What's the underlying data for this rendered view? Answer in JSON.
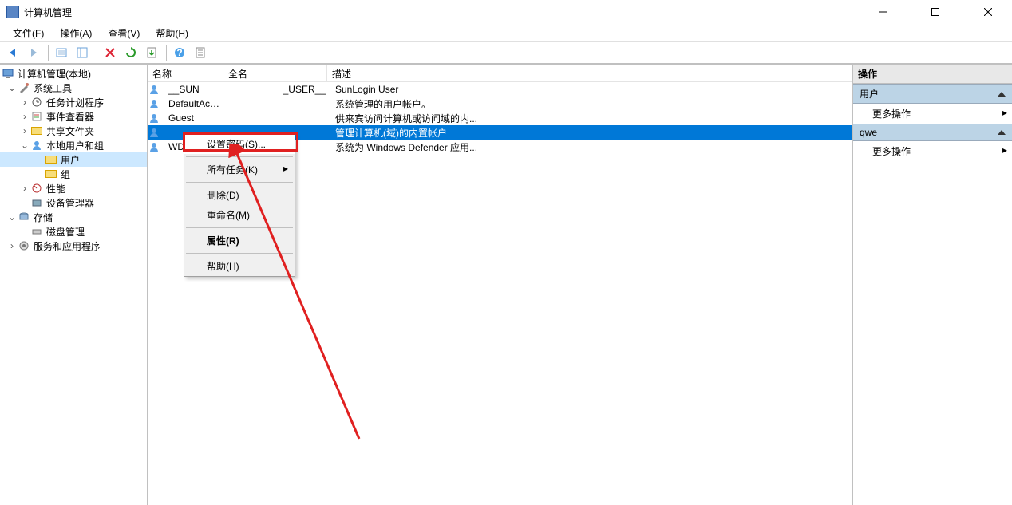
{
  "window": {
    "title": "计算机管理"
  },
  "menus": {
    "file": "文件(F)",
    "action": "操作(A)",
    "view": "查看(V)",
    "help": "帮助(H)"
  },
  "tree": {
    "root": "计算机管理(本地)",
    "sys_tools": "系统工具",
    "task_sched": "任务计划程序",
    "event_viewer": "事件查看器",
    "shared_folders": "共享文件夹",
    "local_users_groups": "本地用户和组",
    "users": "用户",
    "groups": "组",
    "perf": "性能",
    "devmgr": "设备管理器",
    "storage": "存储",
    "diskmgmt": "磁盘管理",
    "services_apps": "服务和应用程序"
  },
  "list": {
    "columns": {
      "name": "名称",
      "fullname": "全名",
      "desc": "描述"
    },
    "rows": [
      {
        "name": "__SUN",
        "fullname": "_USER__",
        "desc": "SunLogin User"
      },
      {
        "name": "DefaultAcc...",
        "fullname": "",
        "desc": "系统管理的用户帐户。"
      },
      {
        "name": "Guest",
        "fullname": "",
        "desc": "供来宾访问计算机或访问域的内..."
      },
      {
        "name": "",
        "fullname": "",
        "desc": "管理计算机(域)的内置帐户",
        "selected": true
      },
      {
        "name": "WD",
        "fullname": "",
        "desc": "系统为 Windows Defender 应用..."
      }
    ]
  },
  "ctx": {
    "set_password": "设置密码(S)...",
    "all_tasks": "所有任务(K)",
    "delete": "删除(D)",
    "rename": "重命名(M)",
    "properties": "属性(R)",
    "help": "帮助(H)"
  },
  "actions": {
    "header": "操作",
    "group1": "用户",
    "more1": "更多操作",
    "group2": "qwe",
    "more2": "更多操作"
  }
}
